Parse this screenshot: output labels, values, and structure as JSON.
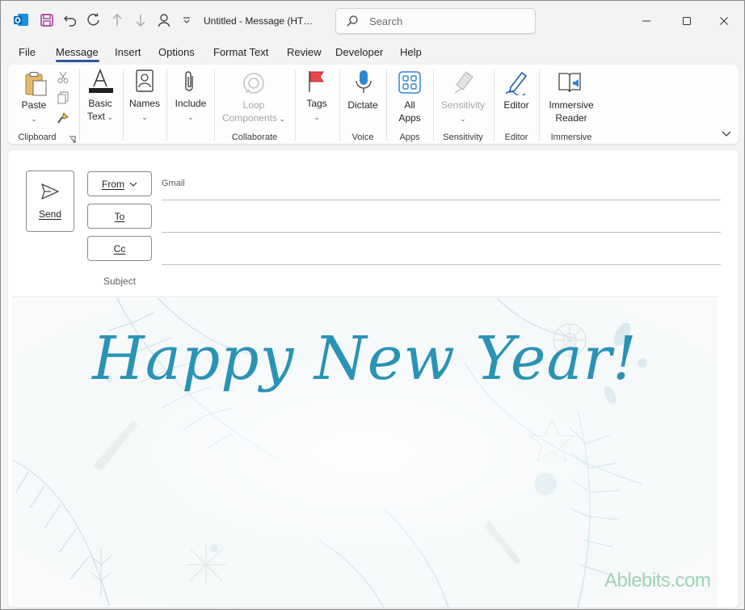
{
  "window": {
    "title": "Untitled  -  Message (HT…"
  },
  "quick_access": {
    "icons": [
      "outlook-logo-icon",
      "save-icon",
      "undo-icon",
      "redo-icon",
      "up-arrow-icon",
      "down-arrow-icon",
      "person-icon",
      "customize-dropdown-icon"
    ]
  },
  "search": {
    "placeholder": "Search"
  },
  "menu": {
    "tabs": [
      "File",
      "Message",
      "Insert",
      "Options",
      "Format Text",
      "Review",
      "Developer",
      "Help"
    ],
    "active": "Message"
  },
  "ribbon": {
    "paste": "Paste",
    "basic_text_1": "Basic",
    "basic_text_2": "Text",
    "names": "Names",
    "include": "Include",
    "loop_1": "Loop",
    "loop_2": "Components",
    "tags": "Tags",
    "dictate": "Dictate",
    "all_apps_1": "All",
    "all_apps_2": "Apps",
    "sensitivity": "Sensitivity",
    "editor": "Editor",
    "immersive_1": "Immersive",
    "immersive_2": "Reader",
    "groups": {
      "clipboard": "Clipboard",
      "collaborate": "Collaborate",
      "voice": "Voice",
      "apps": "Apps",
      "sensitivity": "Sensitivity",
      "editor": "Editor",
      "immersive": "Immersive"
    }
  },
  "compose": {
    "send": "Send",
    "from_label": "From",
    "from_value": "Gmail",
    "to_label": "To",
    "cc_label": "Cc",
    "subject_label": "Subject",
    "greeting": "Happy New Year!",
    "watermark": "Ablebits.com"
  },
  "colors": {
    "accent": "#2b579a",
    "greeting": "#2a93b5",
    "watermark": "#9fd2b6",
    "tags_flag": "#e8474c"
  }
}
